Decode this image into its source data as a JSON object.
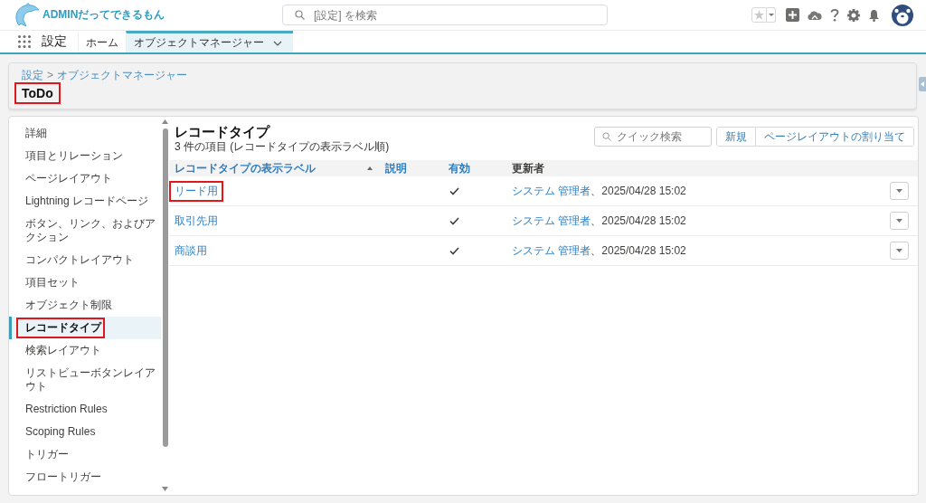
{
  "header": {
    "logo_text": "ADMINだってできるもん",
    "search": {
      "placeholder": "[設定] を検索"
    }
  },
  "nav": {
    "app_name": "設定",
    "tabs": [
      {
        "label": "ホーム",
        "selected": false,
        "has_menu": false
      },
      {
        "label": "オブジェクトマネージャー",
        "selected": true,
        "has_menu": true
      }
    ]
  },
  "page_header": {
    "breadcrumbs": [
      "設定",
      "オブジェクトマネージャー"
    ],
    "separator": ">",
    "title": "ToDo",
    "highlighted": true
  },
  "sidebar": {
    "items": [
      {
        "label": "詳細",
        "selected": false,
        "highlighted": false
      },
      {
        "label": "項目とリレーション",
        "selected": false,
        "highlighted": false
      },
      {
        "label": "ページレイアウト",
        "selected": false,
        "highlighted": false
      },
      {
        "label": "Lightning レコードページ",
        "selected": false,
        "highlighted": false
      },
      {
        "label": "ボタン、リンク、およびアクション",
        "selected": false,
        "highlighted": false
      },
      {
        "label": "コンパクトレイアウト",
        "selected": false,
        "highlighted": false
      },
      {
        "label": "項目セット",
        "selected": false,
        "highlighted": false
      },
      {
        "label": "オブジェクト制限",
        "selected": false,
        "highlighted": false
      },
      {
        "label": "レコードタイプ",
        "selected": true,
        "highlighted": true
      },
      {
        "label": "検索レイアウト",
        "selected": false,
        "highlighted": false
      },
      {
        "label": "リストビューボタンレイアウト",
        "selected": false,
        "highlighted": false
      },
      {
        "label": "Restriction Rules",
        "selected": false,
        "highlighted": false
      },
      {
        "label": "Scoping Rules",
        "selected": false,
        "highlighted": false
      },
      {
        "label": "トリガー",
        "selected": false,
        "highlighted": false
      },
      {
        "label": "フロートリガー",
        "selected": false,
        "highlighted": false
      }
    ]
  },
  "record_types": {
    "title": "レコードタイプ",
    "subtitle": "3 件の項目 (レコードタイプの表示ラベル順)",
    "search": {
      "placeholder": "クイック検索"
    },
    "buttons": [
      "新規",
      "ページレイアウトの割り当て"
    ],
    "table": {
      "columns": [
        {
          "label": "レコードタイプの表示ラベル",
          "sortable": true,
          "sorted": true
        },
        {
          "label": "説明",
          "sortable": true,
          "sorted": false
        },
        {
          "label": "有効",
          "sortable": true,
          "sorted": false
        },
        {
          "label": "更新者",
          "sortable": false,
          "sorted": false
        }
      ],
      "rows": [
        {
          "label": "リード用",
          "highlighted": true,
          "active": true,
          "modified_by": "システム 管理者",
          "modified_at": "、2025/04/28 15:02"
        },
        {
          "label": "取引先用",
          "highlighted": false,
          "active": true,
          "modified_by": "システム 管理者",
          "modified_at": "、2025/04/28 15:02"
        },
        {
          "label": "商談用",
          "highlighted": false,
          "active": true,
          "modified_by": "システム 管理者",
          "modified_at": "、2025/04/28 15:02"
        }
      ]
    }
  }
}
